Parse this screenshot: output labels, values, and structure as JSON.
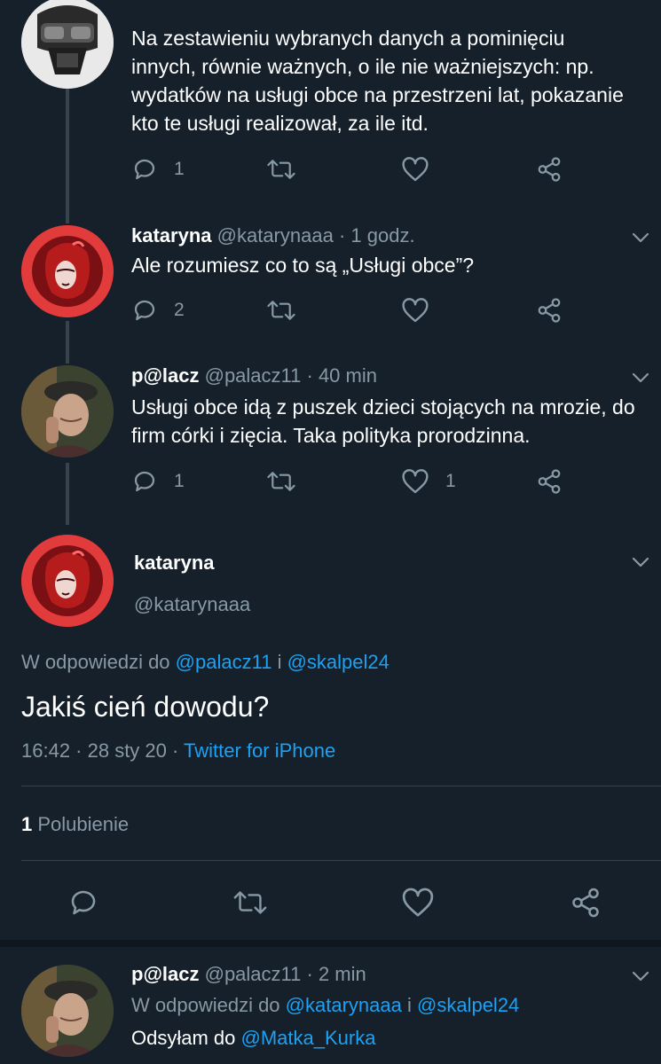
{
  "tweets": [
    {
      "text": "Na zestawieniu wybranych danych a pominięciu innych, równie ważnych, o ile nie ważniejszych: np. wydatków na usługi obce na przestrzeni lat, pokazanie kto te usługi realizował, za ile itd.",
      "reply_count": "1",
      "like_count": ""
    },
    {
      "name": "kataryna",
      "handle": "@katarynaaa",
      "time": "· 1 godz.",
      "text": "Ale rozumiesz co to są „Usługi obce”?",
      "reply_count": "2",
      "like_count": ""
    },
    {
      "name": "p@lacz",
      "handle": "@palacz11",
      "time": "· 40 min",
      "text": "Usługi obce idą z puszek dzieci stojących na mrozie, do firm córki i zięcia. Taka polityka prorodzinna.",
      "reply_count": "1",
      "like_count": "1"
    }
  ],
  "main": {
    "name": "kataryna",
    "handle": "@katarynaaa",
    "reply_prefix": "W odpowiedzi do",
    "reply_user1": "@palacz11",
    "reply_and": "i",
    "reply_user2": "@skalpel24",
    "text": "Jakiś cień dowodu?",
    "datetime": "16:42 · 28 sty 20 ·",
    "source": "Twitter for iPhone",
    "likes_count": "1",
    "likes_label": "Polubienie"
  },
  "last": {
    "name": "p@lacz",
    "handle": "@palacz11",
    "time": "· 2 min",
    "reply_prefix": "W odpowiedzi do",
    "reply_user1": "@katarynaaa",
    "reply_and": "i",
    "reply_user2": "@skalpel24",
    "text_prefix": "Odsyłam do",
    "mention": "@Matka_Kurka"
  },
  "colors": {
    "background": "#15202b",
    "muted": "#8899a6",
    "link": "#1da1f2",
    "line": "#38444d"
  }
}
